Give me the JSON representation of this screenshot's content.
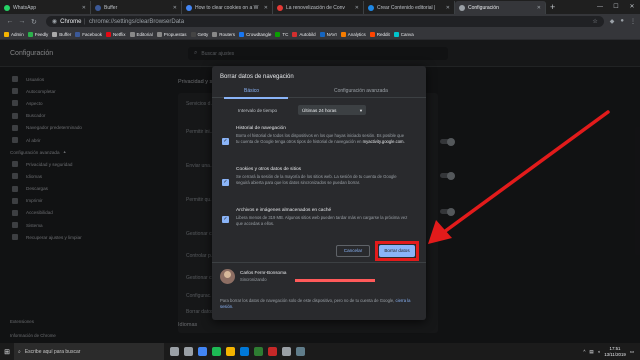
{
  "tabs": [
    {
      "title": "WhatsApp",
      "color": "#25d366",
      "active": false
    },
    {
      "title": "Buffer",
      "color": "#3b5998",
      "active": false
    },
    {
      "title": "How to clear cookies on a W",
      "color": "#4285f4",
      "active": false
    },
    {
      "title": "La renovelización de Conv",
      "color": "#e53935",
      "active": false
    },
    {
      "title": "Crear Contenido editorial |",
      "color": "#1e88e5",
      "active": false
    },
    {
      "title": "Configuración",
      "color": "#9aa0a6",
      "active": true
    }
  ],
  "omnibox": {
    "site": "Chrome",
    "url": "chrome://settings/clearBrowserData"
  },
  "bookmarks": [
    {
      "label": "Admin",
      "color": "#f4b400"
    },
    {
      "label": "Feedly",
      "color": "#2bb24c"
    },
    {
      "label": "Buffer",
      "color": "#aaaaaa"
    },
    {
      "label": "Facebook",
      "color": "#3b5998"
    },
    {
      "label": "Netflix",
      "color": "#e50914"
    },
    {
      "label": "Editorial",
      "color": "#888888"
    },
    {
      "label": "Propuestas",
      "color": "#888888"
    },
    {
      "label": "Getty",
      "color": "#444444"
    },
    {
      "label": "Routers",
      "color": "#888888"
    },
    {
      "label": "Crowdtangle",
      "color": "#1877f2"
    },
    {
      "label": "TC",
      "color": "#0a9e01"
    },
    {
      "label": "Autobild",
      "color": "#d32f2f"
    },
    {
      "label": "NAVI",
      "color": "#1565c0"
    },
    {
      "label": "Analytics",
      "color": "#f57c00"
    },
    {
      "label": "Reddit",
      "color": "#ff4500"
    },
    {
      "label": "Canva",
      "color": "#00c4cc"
    }
  ],
  "settings": {
    "title": "Configuración",
    "search_placeholder": "Buscar ajustes"
  },
  "sidebar": {
    "items": [
      {
        "label": "Usuarios"
      },
      {
        "label": "Autocompletar"
      },
      {
        "label": "Aspecto"
      },
      {
        "label": "Buscador"
      },
      {
        "label": "Navegador predeterminado"
      },
      {
        "label": "Al abrir"
      }
    ],
    "advanced_label": "Configuración avanzada",
    "advanced_items": [
      {
        "label": "Privacidad y seguridad"
      },
      {
        "label": "Idiomas"
      },
      {
        "label": "Descargas"
      },
      {
        "label": "Imprimir"
      },
      {
        "label": "Accesibilidad"
      },
      {
        "label": "Sistema"
      },
      {
        "label": "Recuperar ajustes y limpiar"
      }
    ],
    "extensions_label": "Extensiones",
    "about_label": "Información de Chrome"
  },
  "background": {
    "section_title": "Privacidad y seg...",
    "rows": [
      "Servicios d...",
      "Permitir ini...",
      "Enviar una...",
      "Permitir qu...",
      "Gestionar c...",
      "Controlar p...",
      "Gestionar c...",
      "Configurac...",
      "Borrar datos"
    ],
    "bottom_title": "Idiomas"
  },
  "dialog": {
    "title": "Borrar datos de navegación",
    "tab_basic": "Básico",
    "tab_advanced": "Configuración avanzada",
    "range_label": "Intervalo de tiempo",
    "range_value": "Últimas 24 horas",
    "options": [
      {
        "title": "Historial de navegación",
        "desc": "Borra el historial de todos los dispositivos en los que hayas iniciado sesión. Es posible que tu cuenta de Google tenga otros tipos de historial de navegación en",
        "link": "myactivity.google.com."
      },
      {
        "title": "Cookies y otros datos de sitios",
        "desc": "Se cerrará la sesión de la mayoría de los sitios web. La sesión de tu cuenta de Google seguirá abierta para que los datos sincronizados se puedan borrar.",
        "link": ""
      },
      {
        "title": "Archivos e imágenes almacenados en caché",
        "desc": "Libera menos de 319 MB. Algunos sitios web pueden tardar más en cargarse la próxima vez que accedas a ellos.",
        "link": ""
      }
    ],
    "cancel_label": "Cancelar",
    "clear_label": "Borrar datos",
    "account_name": "Carlos Fernr-Bonsoma",
    "account_sync": "Sincronizando",
    "footer_text": "Para borrar los datos de navegación solo de este dispositivo, pero no de tu cuenta de Google,",
    "footer_link": "cierra la sesión."
  },
  "taskbar": {
    "search_placeholder": "Escribe aquí para buscar",
    "time": "17:51",
    "date": "13/11/2019",
    "icon_colors": [
      "#9aa0a6",
      "#9aa0a6",
      "#4285f4",
      "#1db954",
      "#f4b400",
      "#0078d7",
      "#2e7d32",
      "#c62828",
      "#9aa0a6",
      "#607d8b"
    ]
  },
  "colors": {
    "accent": "#8ab4f8",
    "annotation": "#e21b1b",
    "surface": "#292a2d",
    "background": "#202124"
  }
}
